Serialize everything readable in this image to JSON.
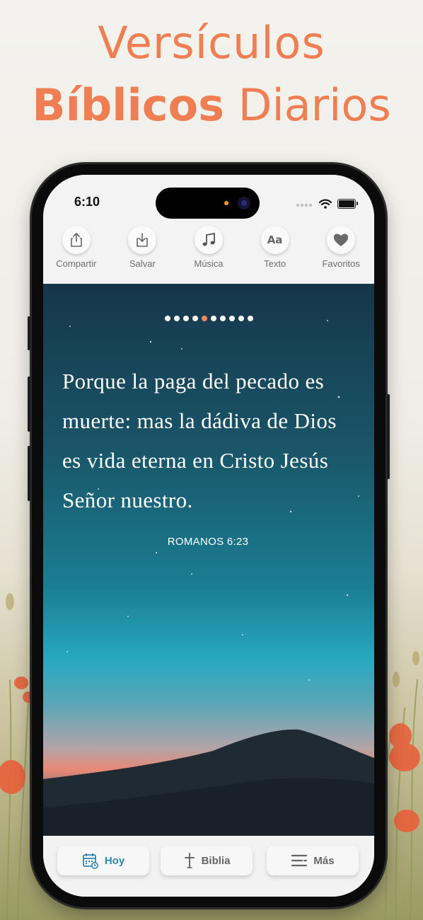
{
  "promo": {
    "line1": "Versículos",
    "line2_bold": "Bíblicos",
    "line2_rest": "Diarios"
  },
  "status_bar": {
    "time": "6:10"
  },
  "toolbar": {
    "share": {
      "label": "Compartir",
      "icon": "share-icon"
    },
    "save": {
      "label": "Salvar",
      "icon": "download-icon"
    },
    "music": {
      "label": "Música",
      "icon": "music-note-icon"
    },
    "text": {
      "label": "Texto",
      "icon_text": "Aa"
    },
    "favorites": {
      "label": "Favoritos",
      "icon": "heart-icon"
    }
  },
  "pager": {
    "count": 10,
    "active_index": 4
  },
  "verse": {
    "text": "Porque la paga del pecado es muerte: mas la dádiva de Dios es vida eterna en Cristo Jesús Señor nuestro.",
    "reference": "ROMANOS 6:23"
  },
  "tabs": {
    "today": {
      "label": "Hoy",
      "active": true,
      "icon": "calendar-icon"
    },
    "bible": {
      "label": "Biblia",
      "icon": "cross-icon"
    },
    "more": {
      "label": "Más",
      "icon": "menu-icon"
    }
  },
  "colors": {
    "accent_orange": "#ef7f52",
    "active_tab_blue": "#2f86b3",
    "pager_active": "#ef8a60"
  }
}
